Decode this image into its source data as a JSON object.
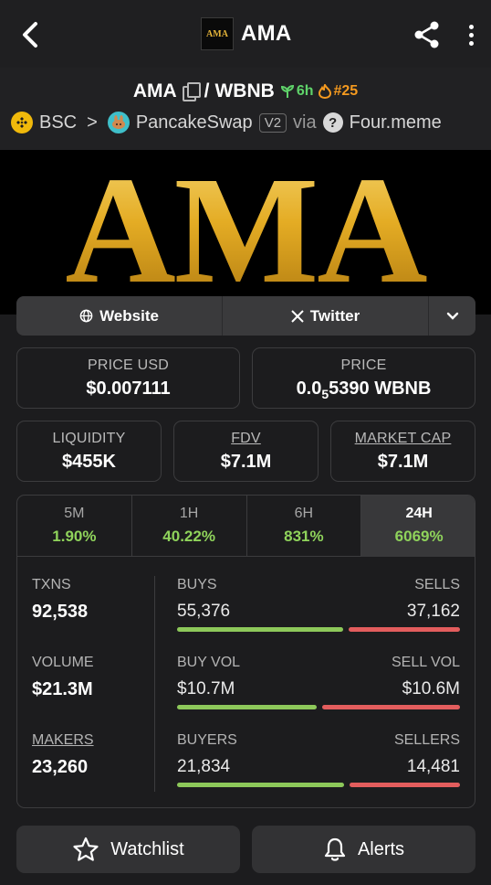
{
  "header": {
    "title": "AMA",
    "logo_text": "AMA"
  },
  "pair": {
    "base": "AMA",
    "separator": "/",
    "quote": "WBNB",
    "age": "6h",
    "rank": "#25"
  },
  "route": {
    "chain": "BSC",
    "arrow": ">",
    "dex": "PancakeSwap",
    "version": "V2",
    "via": "via",
    "launchpad": "Four.meme"
  },
  "banner": {
    "text": "AMA"
  },
  "links": {
    "website": "Website",
    "twitter": "Twitter"
  },
  "price": {
    "usd_label": "PRICE USD",
    "usd_value": "$0.007111",
    "native_label": "PRICE",
    "native_prefix": "0.0",
    "native_subscript": "5",
    "native_digits": "5390 WBNB"
  },
  "metrics": {
    "liquidity_label": "LIQUIDITY",
    "liquidity_value": "$455K",
    "fdv_label": "FDV",
    "fdv_value": "$7.1M",
    "mcap_label": "MARKET CAP",
    "mcap_value": "$7.1M"
  },
  "tabs": [
    {
      "label": "5M",
      "value": "1.90%"
    },
    {
      "label": "1H",
      "value": "40.22%"
    },
    {
      "label": "6H",
      "value": "831%"
    },
    {
      "label": "24H",
      "value": "6069%"
    }
  ],
  "active_tab": "24H",
  "stats": {
    "txns_label": "TXNS",
    "txns_value": "92,538",
    "buys_label": "BUYS",
    "buys_value": "55,376",
    "sells_label": "SELLS",
    "sells_value": "37,162",
    "volume_label": "VOLUME",
    "volume_value": "$21.3M",
    "buy_vol_label": "BUY VOL",
    "buy_vol_value": "$10.7M",
    "sell_vol_label": "SELL VOL",
    "sell_vol_value": "$10.6M",
    "makers_label": "MAKERS",
    "makers_value": "23,260",
    "buyers_label": "BUYERS",
    "buyers_value": "21,834",
    "sellers_label": "SELLERS",
    "sellers_value": "14,481",
    "buys_share": 0.598,
    "buy_vol_share": 0.502,
    "buyers_share": 0.601
  },
  "actions": {
    "watchlist": "Watchlist",
    "alerts": "Alerts"
  },
  "colors": {
    "positive": "#8fd35b",
    "buy_bar": "#8dc85a",
    "sell_bar": "#e35d5d",
    "rank": "#f59a1f",
    "age": "#5fd36a"
  }
}
